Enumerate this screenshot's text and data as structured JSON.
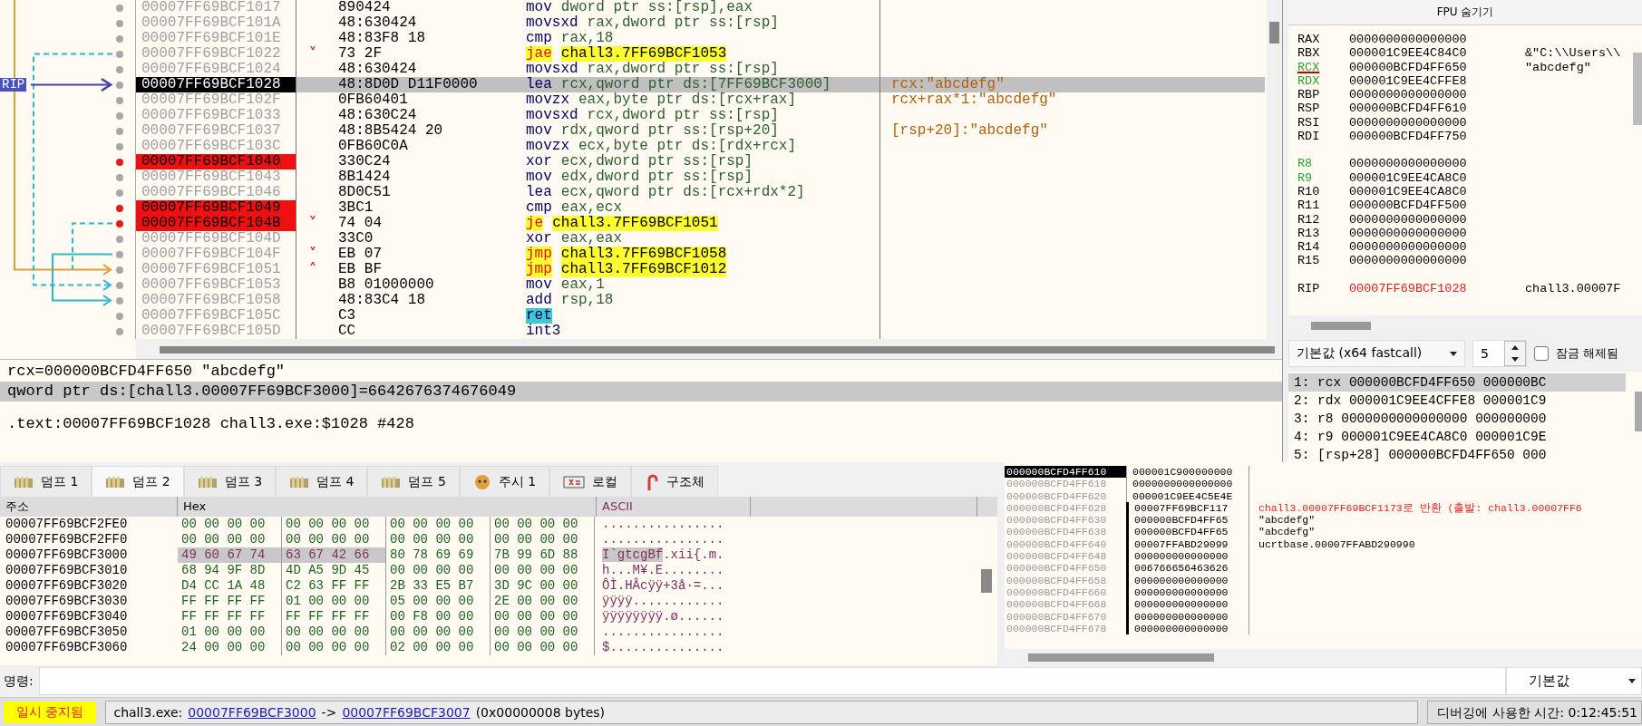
{
  "disassembly": {
    "rip_label": "RIP",
    "rows": [
      {
        "address": "00007FF69BCF1017",
        "bytes": "890424",
        "mnemonic": "mov",
        "operands": "dword ptr ss:[rsp],eax",
        "kind": "normal",
        "breakpoint": false,
        "current": false,
        "selected": false
      },
      {
        "address": "00007FF69BCF101A",
        "bytes": "48:630424",
        "mnemonic": "movsxd",
        "operands": "rax,dword ptr ss:[rsp]",
        "kind": "normal",
        "breakpoint": false,
        "current": false,
        "selected": false
      },
      {
        "address": "00007FF69BCF101E",
        "bytes": "48:83F8 18",
        "mnemonic": "cmp",
        "operands": "rax,18",
        "kind": "normal",
        "breakpoint": false,
        "current": false,
        "selected": false
      },
      {
        "address": "00007FF69BCF1022",
        "bytes": "73 2F",
        "marker": "˅",
        "mnemonic": "jae",
        "operands": "chall3.7FF69BCF1053",
        "kind": "jump",
        "breakpoint": false,
        "current": false,
        "selected": false
      },
      {
        "address": "00007FF69BCF1024",
        "bytes": "48:630424",
        "mnemonic": "movsxd",
        "operands": "rax,dword ptr ss:[rsp]",
        "kind": "normal",
        "breakpoint": false,
        "current": false,
        "selected": false
      },
      {
        "address": "00007FF69BCF1028",
        "bytes": "48:8D0D D11F0000",
        "mnemonic": "lea",
        "operands": "rcx,qword ptr ds:[7FF69BCF3000]",
        "comment": "rcx:\"abcdefg\"",
        "kind": "normal",
        "breakpoint": false,
        "current": true,
        "selected": true
      },
      {
        "address": "00007FF69BCF102F",
        "bytes": "0FB60401",
        "mnemonic": "movzx",
        "operands": "eax,byte ptr ds:[rcx+rax]",
        "comment": "rcx+rax*1:\"abcdefg\"",
        "kind": "normal",
        "breakpoint": false,
        "current": false,
        "selected": false
      },
      {
        "address": "00007FF69BCF1033",
        "bytes": "48:630C24",
        "mnemonic": "movsxd",
        "operands": "rcx,dword ptr ss:[rsp]",
        "kind": "normal",
        "breakpoint": false,
        "current": false,
        "selected": false
      },
      {
        "address": "00007FF69BCF1037",
        "bytes": "48:8B5424 20",
        "mnemonic": "mov",
        "operands": "rdx,qword ptr ss:[rsp+20]",
        "comment": "[rsp+20]:\"abcdefg\"",
        "kind": "normal",
        "breakpoint": false,
        "current": false,
        "selected": false
      },
      {
        "address": "00007FF69BCF103C",
        "bytes": "0FB60C0A",
        "mnemonic": "movzx",
        "operands": "ecx,byte ptr ds:[rdx+rcx]",
        "kind": "normal",
        "breakpoint": false,
        "current": false,
        "selected": false
      },
      {
        "address": "00007FF69BCF1040",
        "bytes": "330C24",
        "mnemonic": "xor",
        "operands": "ecx,dword ptr ss:[rsp]",
        "kind": "normal",
        "breakpoint": true,
        "current": false,
        "selected": false
      },
      {
        "address": "00007FF69BCF1043",
        "bytes": "8B1424",
        "mnemonic": "mov",
        "operands": "edx,dword ptr ss:[rsp]",
        "kind": "normal",
        "breakpoint": false,
        "current": false,
        "selected": false
      },
      {
        "address": "00007FF69BCF1046",
        "bytes": "8D0C51",
        "mnemonic": "lea",
        "operands": "ecx,qword ptr ds:[rcx+rdx*2]",
        "kind": "normal",
        "breakpoint": false,
        "current": false,
        "selected": false
      },
      {
        "address": "00007FF69BCF1049",
        "bytes": "3BC1",
        "mnemonic": "cmp",
        "operands": "eax,ecx",
        "kind": "normal",
        "breakpoint": true,
        "current": false,
        "selected": false
      },
      {
        "address": "00007FF69BCF104B",
        "bytes": "74 04",
        "marker": "˅",
        "mnemonic": "je",
        "operands": "chall3.7FF69BCF1051",
        "kind": "jump",
        "breakpoint": true,
        "current": false,
        "selected": false
      },
      {
        "address": "00007FF69BCF104D",
        "bytes": "33C0",
        "mnemonic": "xor",
        "operands": "eax,eax",
        "kind": "normal",
        "breakpoint": false,
        "current": false,
        "selected": false
      },
      {
        "address": "00007FF69BCF104F",
        "bytes": "EB 07",
        "marker": "˅",
        "mnemonic": "jmp",
        "operands": "chall3.7FF69BCF1058",
        "kind": "jump",
        "breakpoint": false,
        "current": false,
        "selected": false
      },
      {
        "address": "00007FF69BCF1051",
        "bytes": "EB BF",
        "marker": "˄",
        "mnemonic": "jmp",
        "operands": "chall3.7FF69BCF1012",
        "kind": "jump",
        "breakpoint": false,
        "current": false,
        "selected": false
      },
      {
        "address": "00007FF69BCF1053",
        "bytes": "B8 01000000",
        "mnemonic": "mov",
        "operands": "eax,1",
        "kind": "normal",
        "breakpoint": false,
        "current": false,
        "selected": false
      },
      {
        "address": "00007FF69BCF1058",
        "bytes": "48:83C4 18",
        "mnemonic": "add",
        "operands": "rsp,18",
        "kind": "normal",
        "breakpoint": false,
        "current": false,
        "selected": false
      },
      {
        "address": "00007FF69BCF105C",
        "bytes": "C3",
        "mnemonic": "ret",
        "operands": "",
        "kind": "ret",
        "breakpoint": false,
        "current": false,
        "selected": false
      },
      {
        "address": "00007FF69BCF105D",
        "bytes": "CC",
        "mnemonic": "int3",
        "operands": "",
        "kind": "normal",
        "breakpoint": false,
        "current": false,
        "selected": false
      }
    ]
  },
  "info": {
    "lines": [
      {
        "text": "rcx=000000BCFD4FF650 \"abcdefg\"",
        "selected": false
      },
      {
        "text": "qword ptr ds:[chall3.00007FF69BCF3000]=6642676374676049",
        "selected": true
      },
      {
        "text": ".text:00007FF69BCF1028 chall3.exe:$1028 #428",
        "selected": false
      }
    ]
  },
  "registers": {
    "toggle": "FPU 숨기기",
    "groups": [
      [
        {
          "name": "RAX",
          "value": "0000000000000000",
          "changed": false,
          "selected": false,
          "value_changed": false
        },
        {
          "name": "RBX",
          "value": "000001C9EE4C84C0",
          "comment": "&\"C:\\\\Users\\\\",
          "changed": false,
          "selected": false,
          "value_changed": false
        },
        {
          "name": "RCX",
          "value": "000000BCFD4FF650",
          "comment": "\"abcdefg\"",
          "changed": true,
          "selected": true,
          "value_changed": false
        },
        {
          "name": "RDX",
          "value": "000001C9EE4CFFE8",
          "changed": true,
          "selected": false,
          "value_changed": false
        },
        {
          "name": "RBP",
          "value": "0000000000000000",
          "changed": false,
          "selected": false,
          "value_changed": false
        },
        {
          "name": "RSP",
          "value": "000000BCFD4FF610",
          "changed": false,
          "selected": false,
          "value_changed": false
        },
        {
          "name": "RSI",
          "value": "0000000000000000",
          "changed": false,
          "selected": false,
          "value_changed": false
        },
        {
          "name": "RDI",
          "value": "000000BCFD4FF750",
          "changed": false,
          "selected": false,
          "value_changed": false
        }
      ],
      [
        {
          "name": "R8",
          "value": "0000000000000000",
          "changed": true,
          "selected": false,
          "value_changed": false
        },
        {
          "name": "R9",
          "value": "000001C9EE4CA8C0",
          "changed": true,
          "selected": false,
          "value_changed": false
        },
        {
          "name": "R10",
          "value": "000001C9EE4CA8C0",
          "changed": false,
          "selected": false,
          "value_changed": false
        },
        {
          "name": "R11",
          "value": "000000BCFD4FF500",
          "changed": false,
          "selected": false,
          "value_changed": false
        },
        {
          "name": "R12",
          "value": "0000000000000000",
          "changed": false,
          "selected": false,
          "value_changed": false
        },
        {
          "name": "R13",
          "value": "0000000000000000",
          "changed": false,
          "selected": false,
          "value_changed": false
        },
        {
          "name": "R14",
          "value": "0000000000000000",
          "changed": false,
          "selected": false,
          "value_changed": false
        },
        {
          "name": "R15",
          "value": "0000000000000000",
          "changed": false,
          "selected": false,
          "value_changed": false
        }
      ],
      [
        {
          "name": "RIP",
          "value": "00007FF69BCF1028",
          "comment": "chall3.00007F",
          "changed": false,
          "selected": false,
          "value_changed": true
        }
      ]
    ]
  },
  "call_convention": {
    "value": "기본값 (x64 fastcall)",
    "count": "5",
    "lock_label": "잠금 해제됨",
    "locked": false
  },
  "arguments": [
    {
      "text": "1: rcx 000000BCFD4FF650 000000BC",
      "selected": true
    },
    {
      "text": "2: rdx 000001C9EE4CFFE8 000001C9",
      "selected": false
    },
    {
      "text": "3: r8 0000000000000000 000000000",
      "selected": false
    },
    {
      "text": "4: r9 000001C9EE4CA8C0 000001C9E",
      "selected": false
    },
    {
      "text": "5: [rsp+28] 000000BCFD4FF650 000",
      "selected": false
    }
  ],
  "tabs": [
    {
      "label": "덤프 1",
      "kind": "dump",
      "selected": false
    },
    {
      "label": "덤프 2",
      "kind": "dump",
      "selected": true
    },
    {
      "label": "덤프 3",
      "kind": "dump",
      "selected": false
    },
    {
      "label": "덤프 4",
      "kind": "dump",
      "selected": false
    },
    {
      "label": "덤프 5",
      "kind": "dump",
      "selected": false
    },
    {
      "label": "주시 1",
      "kind": "watch",
      "selected": false
    },
    {
      "label": "로컬",
      "kind": "locals",
      "selected": false
    },
    {
      "label": "구조체",
      "kind": "struct",
      "selected": false
    }
  ],
  "dump": {
    "columns": [
      "주소",
      "Hex",
      "ASCII"
    ],
    "rows": [
      {
        "address": "00007FF69BCF2FE0",
        "hex": [
          {
            "bytes": "00 00 00 00",
            "selected": false
          },
          {
            "bytes": "00 00 00 00",
            "selected": false
          },
          {
            "bytes": "00 00 00 00",
            "selected": false
          },
          {
            "bytes": "00 00 00 00",
            "selected": false
          }
        ],
        "ascii": [
          {
            "text": "................",
            "selected": false
          }
        ]
      },
      {
        "address": "00007FF69BCF2FF0",
        "hex": [
          {
            "bytes": "00 00 00 00",
            "selected": false
          },
          {
            "bytes": "00 00 00 00",
            "selected": false
          },
          {
            "bytes": "00 00 00 00",
            "selected": false
          },
          {
            "bytes": "00 00 00 00",
            "selected": false
          }
        ],
        "ascii": [
          {
            "text": "................",
            "selected": false
          }
        ]
      },
      {
        "address": "00007FF69BCF3000",
        "hex": [
          {
            "bytes": "49 60 67 74",
            "selected": true
          },
          {
            "bytes": "63 67 42 66",
            "selected": true
          },
          {
            "bytes": "80 78 69 69",
            "selected": false
          },
          {
            "bytes": "7B 99 6D 88",
            "selected": false
          }
        ],
        "ascii": [
          {
            "text": "I`gtcgBf",
            "selected": true
          },
          {
            "text": ".xii{.m.",
            "selected": false
          }
        ]
      },
      {
        "address": "00007FF69BCF3010",
        "hex": [
          {
            "bytes": "68 94 9F 8D",
            "selected": false
          },
          {
            "bytes": "4D A5 9D 45",
            "selected": false
          },
          {
            "bytes": "00 00 00 00",
            "selected": false
          },
          {
            "bytes": "00 00 00 00",
            "selected": false
          }
        ],
        "ascii": [
          {
            "text": "h...M¥.E........",
            "selected": false
          }
        ]
      },
      {
        "address": "00007FF69BCF3020",
        "hex": [
          {
            "bytes": "D4 CC 1A 48",
            "selected": false
          },
          {
            "bytes": "C2 63 FF FF",
            "selected": false
          },
          {
            "bytes": "2B 33 E5 B7",
            "selected": false
          },
          {
            "bytes": "3D 9C 00 00",
            "selected": false
          }
        ],
        "ascii": [
          {
            "text": "ÔÌ.HÂcÿÿ+3å·=...",
            "selected": false
          }
        ]
      },
      {
        "address": "00007FF69BCF3030",
        "hex": [
          {
            "bytes": "FF FF FF FF",
            "selected": false
          },
          {
            "bytes": "01 00 00 00",
            "selected": false
          },
          {
            "bytes": "05 00 00 00",
            "selected": false
          },
          {
            "bytes": "2E 00 00 00",
            "selected": false
          }
        ],
        "ascii": [
          {
            "text": "ÿÿÿÿ............",
            "selected": false
          }
        ]
      },
      {
        "address": "00007FF69BCF3040",
        "hex": [
          {
            "bytes": "FF FF FF FF",
            "selected": false
          },
          {
            "bytes": "FF FF FF FF",
            "selected": false
          },
          {
            "bytes": "00 F8 00 00",
            "selected": false
          },
          {
            "bytes": "00 00 00 00",
            "selected": false
          }
        ],
        "ascii": [
          {
            "text": "ÿÿÿÿÿÿÿÿ.ø......",
            "selected": false
          }
        ]
      },
      {
        "address": "00007FF69BCF3050",
        "hex": [
          {
            "bytes": "01 00 00 00",
            "selected": false
          },
          {
            "bytes": "00 00 00 00",
            "selected": false
          },
          {
            "bytes": "00 00 00 00",
            "selected": false
          },
          {
            "bytes": "00 00 00 00",
            "selected": false
          }
        ],
        "ascii": [
          {
            "text": "................",
            "selected": false
          }
        ]
      },
      {
        "address": "00007FF69BCF3060",
        "hex": [
          {
            "bytes": "24 00 00 00",
            "selected": false
          },
          {
            "bytes": "00 00 00 00",
            "selected": false
          },
          {
            "bytes": "02 00 00 00",
            "selected": false
          },
          {
            "bytes": "00 00 00 00",
            "selected": false
          }
        ],
        "ascii": [
          {
            "text": "$...............",
            "selected": false
          }
        ]
      }
    ]
  },
  "stack": {
    "rows": [
      {
        "address": "000000BCFD4FF610",
        "value": "000001C900000000",
        "selected": true,
        "in_frame": false
      },
      {
        "address": "000000BCFD4FF618",
        "value": "0000000000000000",
        "selected": false,
        "in_frame": false
      },
      {
        "address": "000000BCFD4FF620",
        "value": "000001C9EE4C5E4E",
        "selected": false,
        "in_frame": false
      },
      {
        "address": "000000BCFD4FF628",
        "value": "00007FF69BCF117",
        "comment": {
          "text": "chall3.00007FF69BCF1173로 반환 (출발: chall3.00007FF6",
          "kind": "return"
        },
        "selected": false,
        "in_frame": true
      },
      {
        "address": "000000BCFD4FF630",
        "value": "000000BCFD4FF65",
        "comment": {
          "text": "\"abcdefg\"",
          "kind": "plain"
        },
        "selected": false,
        "in_frame": true
      },
      {
        "address": "000000BCFD4FF638",
        "value": "000000BCFD4FF65",
        "comment": {
          "text": "\"abcdefg\"",
          "kind": "plain"
        },
        "selected": false,
        "in_frame": true
      },
      {
        "address": "000000BCFD4FF640",
        "value": "00007FFABD29099",
        "comment": {
          "text": "ucrtbase.00007FFABD290990",
          "kind": "plain"
        },
        "selected": false,
        "in_frame": true
      },
      {
        "address": "000000BCFD4FF648",
        "value": "000000000000000",
        "selected": false,
        "in_frame": true
      },
      {
        "address": "000000BCFD4FF650",
        "value": "006766656463626",
        "selected": false,
        "in_frame": true
      },
      {
        "address": "000000BCFD4FF658",
        "value": "000000000000000",
        "selected": false,
        "in_frame": true
      },
      {
        "address": "000000BCFD4FF660",
        "value": "000000000000000",
        "selected": false,
        "in_frame": true
      },
      {
        "address": "000000BCFD4FF668",
        "value": "000000000000000",
        "selected": false,
        "in_frame": true
      },
      {
        "address": "000000BCFD4FF670",
        "value": "000000000000000",
        "selected": false,
        "in_frame": true
      },
      {
        "address": "000000BCFD4FF678",
        "value": "000000000000000",
        "selected": false,
        "in_frame": true
      }
    ]
  },
  "command": {
    "label": "명령:",
    "mode": "기본값"
  },
  "status": {
    "state": "일시 중지됨",
    "module": "chall3.exe:",
    "from": "00007FF69BCF3000",
    "arrow": "->",
    "to": "00007FF69BCF3007",
    "size": "(0x00000008 bytes)",
    "timer": "디버깅에 사용한 시간: 0:12:45:51"
  }
}
